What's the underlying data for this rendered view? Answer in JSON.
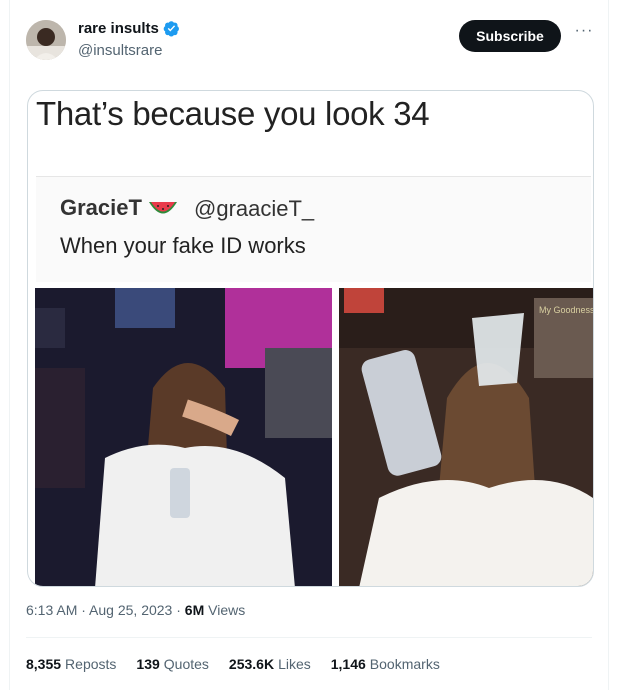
{
  "author": {
    "name": "rare insults",
    "handle": "@insultsrare"
  },
  "subscribe_label": "Subscribe",
  "media": {
    "caption": "That’s because you look 34",
    "embedded_tweet": {
      "name": "GracieT",
      "handle": "@graacieT_",
      "text": "When your fake ID works"
    },
    "photo_right_sign": "My Goodness My Cup"
  },
  "meta": {
    "time": "6:13 AM",
    "date": "Aug 25, 2023",
    "views_count": "6M",
    "views_label": "Views"
  },
  "stats": [
    {
      "count": "8,355",
      "label": "Reposts"
    },
    {
      "count": "139",
      "label": "Quotes"
    },
    {
      "count": "253.6K",
      "label": "Likes"
    },
    {
      "count": "1,146",
      "label": "Bookmarks"
    }
  ],
  "colors": {
    "verified": "#1d9bf0",
    "button_bg": "#0f1419",
    "muted": "#536471"
  }
}
